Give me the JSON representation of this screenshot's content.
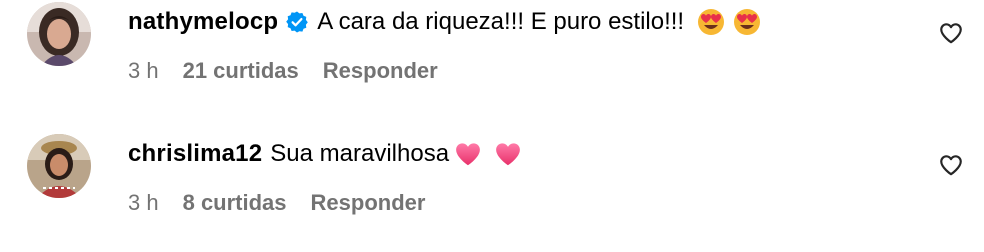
{
  "comments": [
    {
      "username": "nathymelocp",
      "verified": true,
      "text": "A cara da riqueza!!! E puro estilo!!!",
      "emojis": [
        "heart-eyes-emoji",
        "heart-eyes-emoji"
      ],
      "time": "3 h",
      "likes": "21 curtidas",
      "reply_label": "Responder",
      "like_icon": "heart-outline-icon"
    },
    {
      "username": "chrislima12",
      "verified": false,
      "text": "Sua maravilhosa",
      "emojis": [
        "pink-heart-emoji",
        "pink-heart-emoji"
      ],
      "time": "3 h",
      "likes": "8 curtidas",
      "reply_label": "Responder",
      "like_icon": "heart-outline-icon"
    }
  ],
  "colors": {
    "text": "#000000",
    "meta": "#737373",
    "verified_badge": "#0095f6",
    "background": "#ffffff"
  }
}
